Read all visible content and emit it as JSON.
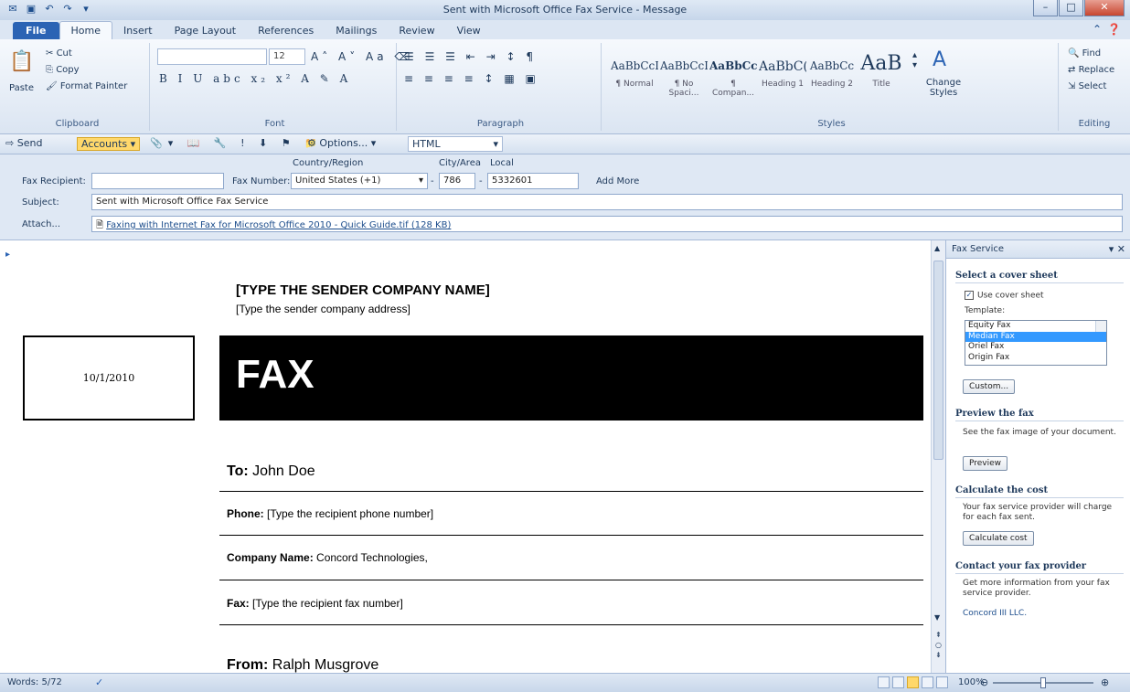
{
  "window": {
    "title": "Sent with Microsoft Office Fax Service - Message"
  },
  "ribbon_tabs": [
    "File",
    "Home",
    "Insert",
    "Page Layout",
    "References",
    "Mailings",
    "Review",
    "View"
  ],
  "clipboard": {
    "paste": "Paste",
    "cut": "Cut",
    "copy": "Copy",
    "format_painter": "Format Painter",
    "label": "Clipboard"
  },
  "font": {
    "size": "12",
    "label": "Font"
  },
  "paragraph": {
    "label": "Paragraph"
  },
  "styles": {
    "label": "Styles",
    "items": [
      {
        "sample": "AaBbCcDc",
        "name": "¶ Normal"
      },
      {
        "sample": "AaBbCcDc",
        "name": "¶ No Spaci..."
      },
      {
        "sample": "AaBbCc",
        "name": "¶ Compan..."
      },
      {
        "sample": "AaBbC(",
        "name": "Heading 1"
      },
      {
        "sample": "AaBbCc",
        "name": "Heading 2"
      },
      {
        "sample": "AaB",
        "name": "Title"
      }
    ],
    "change_styles": "Change Styles"
  },
  "editing": {
    "label": "Editing",
    "find": "Find",
    "replace": "Replace",
    "select": "Select"
  },
  "toolbar": {
    "send": "Send",
    "accounts": "Accounts",
    "options": "Options...",
    "format": "HTML"
  },
  "fields": {
    "fax_recipient_label": "Fax Recipient:",
    "fax_recipient_value": "",
    "fax_number_label": "Fax Number:",
    "country_region_label": "Country/Region",
    "country_value": "United States (+1)",
    "city_area_label": "City/Area",
    "city_value": "786",
    "local_label": "Local",
    "local_value": "5332601",
    "add_more": "Add More",
    "subject_label": "Subject:",
    "subject_value": "Sent with Microsoft Office Fax Service",
    "attach_label": "Attach...",
    "attach_value": "Faxing with Internet Fax for Microsoft Office 2010 - Quick Guide.tif (128 KB)"
  },
  "document": {
    "company": "[TYPE THE SENDER COMPANY NAME]",
    "address": "[Type the sender company address]",
    "date": "10/1/2010",
    "banner": "FAX",
    "to_label": "To:",
    "to_value": " John Doe",
    "phone_label": "Phone:",
    "phone_value": " [Type the recipient phone number]",
    "company_label": "Company Name:",
    "company_value": " Concord Technologies,",
    "fax_label": "Fax:",
    "fax_value": " [Type the recipient fax number]",
    "from_label": "From:",
    "from_value": " Ralph Musgrove"
  },
  "pane": {
    "title": "Fax Service",
    "cover_heading": "Select a cover sheet",
    "use_cover": "Use cover sheet",
    "template_label": "Template:",
    "templates": [
      "Equity Fax",
      "Median Fax",
      "Oriel Fax",
      "Origin Fax"
    ],
    "selected_template": "Median Fax",
    "custom_btn": "Custom...",
    "preview_heading": "Preview the fax",
    "preview_text": "See the fax image of your document.",
    "preview_btn": "Preview",
    "cost_heading": "Calculate the cost",
    "cost_text": "Your fax service provider will charge for each fax sent.",
    "cost_btn": "Calculate cost",
    "contact_heading": "Contact your fax provider",
    "contact_text": "Get more information from your fax service provider.",
    "contact_link": "Concord III LLC."
  },
  "status": {
    "words": "Words: 5/72",
    "zoom": "100%"
  }
}
